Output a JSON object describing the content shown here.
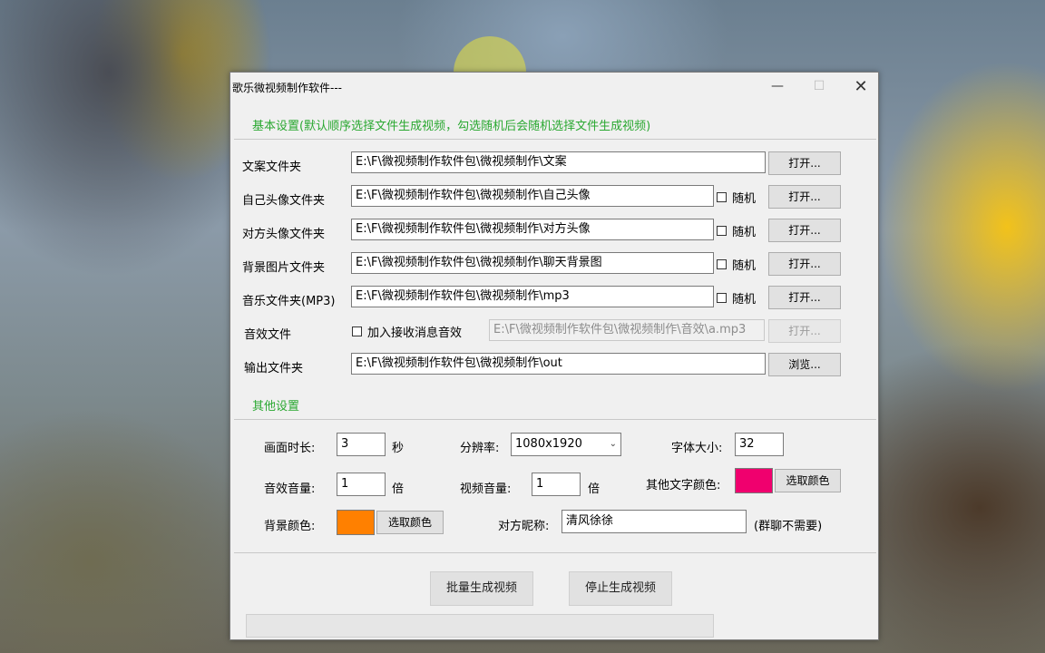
{
  "window": {
    "title": "歌乐微视频制作软件---",
    "minimize": "—",
    "maximize": "☐",
    "close": "✕"
  },
  "basic": {
    "section_title": "基本设置(默认顺序选择文件生成视频，勾选随机后会随机选择文件生成视频)",
    "rows": [
      {
        "label": "文案文件夹",
        "path": "E:\\F\\微视频制作软件包\\微视频制作\\文案",
        "button": "打开..."
      },
      {
        "label": "自己头像文件夹",
        "path": "E:\\F\\微视频制作软件包\\微视频制作\\自己头像",
        "random": "随机",
        "button": "打开..."
      },
      {
        "label": "对方头像文件夹",
        "path": "E:\\F\\微视频制作软件包\\微视频制作\\对方头像",
        "random": "随机",
        "button": "打开..."
      },
      {
        "label": "背景图片文件夹",
        "path": "E:\\F\\微视频制作软件包\\微视频制作\\聊天背景图",
        "random": "随机",
        "button": "打开..."
      },
      {
        "label": "音乐文件夹(MP3)",
        "path": "E:\\F\\微视频制作软件包\\微视频制作\\mp3",
        "random": "随机",
        "button": "打开..."
      }
    ],
    "sound": {
      "label": "音效文件",
      "checkbox": "加入接收消息音效",
      "path": "E:\\F\\微视频制作软件包\\微视频制作\\音效\\a.mp3",
      "button": "打开..."
    },
    "output": {
      "label": "输出文件夹",
      "path": "E:\\F\\微视频制作软件包\\微视频制作\\out",
      "button": "浏览..."
    }
  },
  "other": {
    "section_title": "其他设置",
    "duration_label": "画面时长:",
    "duration_value": "3",
    "duration_unit": "秒",
    "resolution_label": "分辨率:",
    "resolution_value": "1080x1920",
    "font_size_label": "字体大小:",
    "font_size_value": "32",
    "sfx_volume_label": "音效音量:",
    "sfx_volume_value": "1",
    "sfx_volume_unit": "倍",
    "video_volume_label": "视频音量:",
    "video_volume_value": "1",
    "video_volume_unit": "倍",
    "other_text_color_label": "其他文字颜色:",
    "other_text_color": "#f0006e",
    "pick_color": "选取颜色",
    "bg_color_label": "背景颜色:",
    "bg_color": "#ff8000",
    "nickname_label": "对方昵称:",
    "nickname_value": "清风徐徐",
    "nickname_note": "(群聊不需要)"
  },
  "actions": {
    "generate": "批量生成视频",
    "stop": "停止生成视频"
  }
}
